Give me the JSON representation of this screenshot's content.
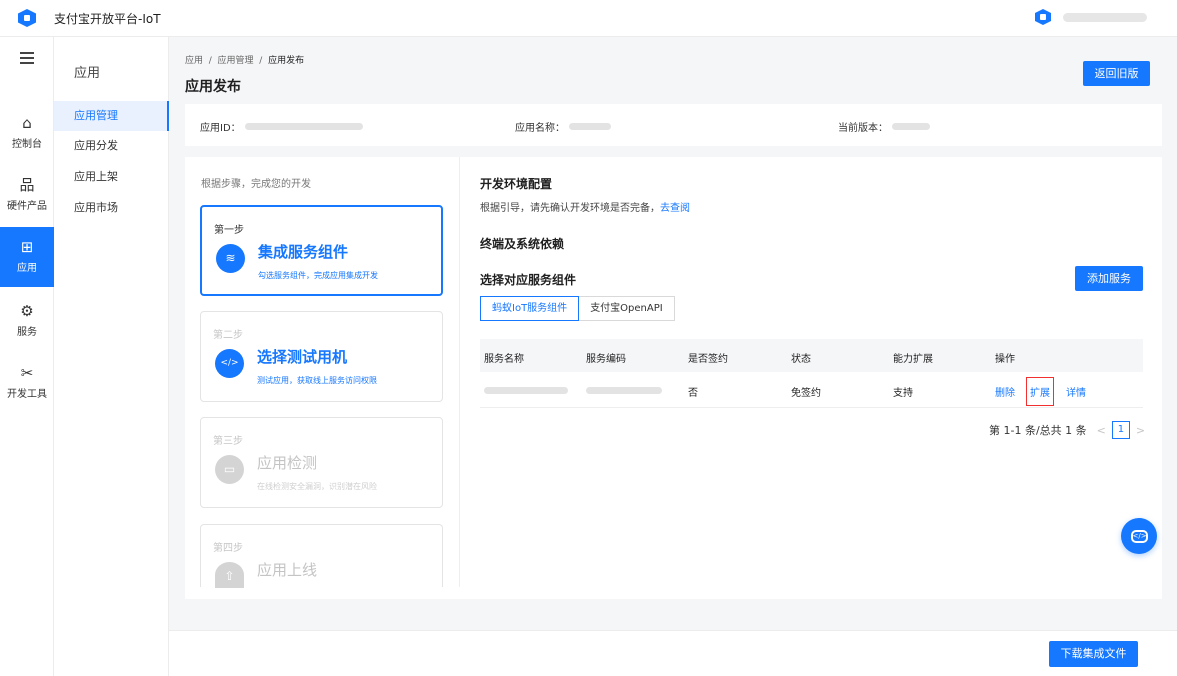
{
  "topbar": {
    "app_title": "支付宝开放平台-IoT"
  },
  "rail": {
    "items": [
      {
        "label": "控制台",
        "icon": "⌂"
      },
      {
        "label": "硬件产品",
        "icon": "品"
      },
      {
        "label": "应用",
        "icon": "⊞"
      },
      {
        "label": "服务",
        "icon": "⚙"
      },
      {
        "label": "开发工具",
        "icon": "✂"
      }
    ]
  },
  "subnav": {
    "title": "应用",
    "items": [
      "应用管理",
      "应用分发",
      "应用上架",
      "应用市场"
    ]
  },
  "breadcrumb": {
    "items": [
      "应用",
      "应用管理",
      "应用发布"
    ],
    "sep": "/"
  },
  "page_title": "应用发布",
  "back_button": "返回旧版",
  "info": {
    "app_id_label": "应用ID：",
    "app_name_label": "应用名称：",
    "version_label": "当前版本："
  },
  "steps": {
    "hint": "根据步骤，完成您的开发",
    "items": [
      {
        "no": "第一步",
        "name": "集成服务组件",
        "desc": "勾选服务组件，完成应用集成开发",
        "icon": "≋"
      },
      {
        "no": "第二步",
        "name": "选择测试用机",
        "desc": "测试应用，获取线上服务访问权限",
        "icon": "</>"
      },
      {
        "no": "第三步",
        "name": "应用检测",
        "desc": "在线检测安全漏洞，识别潜在风险",
        "icon": "▭"
      },
      {
        "no": "第四步",
        "name": "应用上线",
        "desc": "",
        "icon": "⇧"
      }
    ]
  },
  "dev_env": {
    "title": "开发环境配置",
    "desc": "根据引导，请先确认开发环境是否完备，",
    "link": "去查阅"
  },
  "deps_title": "终端及系统依赖",
  "service_section": {
    "title": "选择对应服务组件",
    "add_button": "添加服务",
    "tabs": [
      "蚂蚁IoT服务组件",
      "支付宝OpenAPI"
    ],
    "columns": [
      "服务名称",
      "服务编码",
      "是否签约",
      "状态",
      "能力扩展",
      "操作"
    ],
    "rows": [
      {
        "signed": "否",
        "status": "免签约",
        "extension": "支持",
        "actions": [
          "删除",
          "扩展",
          "详情"
        ]
      }
    ],
    "pager": {
      "summary": "第 1-1 条/总共 1 条",
      "prev": "<",
      "next": ">",
      "current": "1"
    }
  },
  "float_icon": "</>",
  "footer": {
    "download_button": "下载集成文件"
  }
}
